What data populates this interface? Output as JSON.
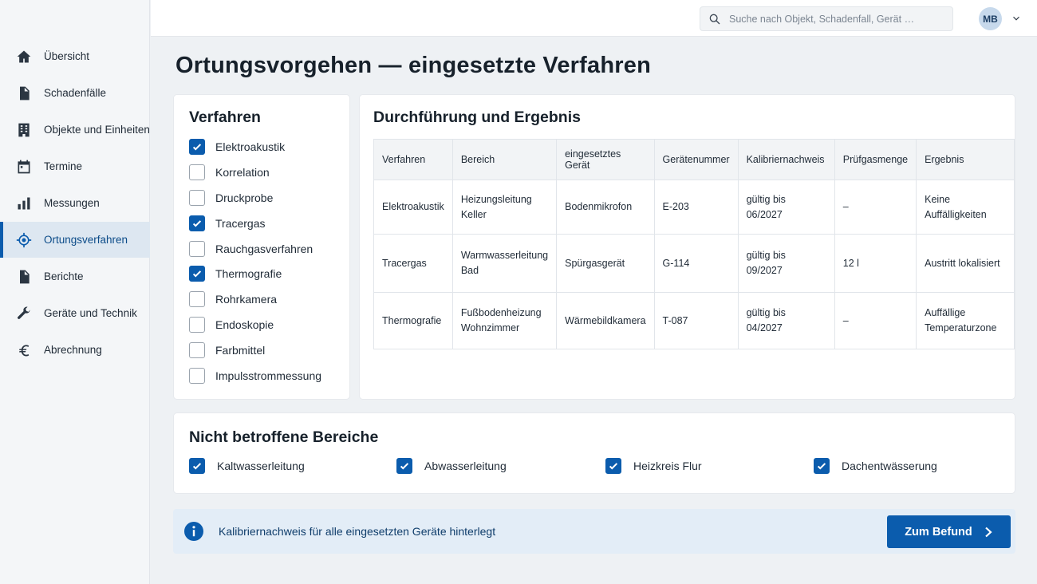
{
  "sidebar": {
    "items": [
      {
        "label": "Übersicht",
        "icon": "home-icon"
      },
      {
        "label": "Schadenfälle",
        "icon": "document-icon"
      },
      {
        "label": "Objekte und Einheiten",
        "icon": "building-icon"
      },
      {
        "label": "Termine",
        "icon": "calendar-icon"
      },
      {
        "label": "Messungen",
        "icon": "bar-chart-icon"
      },
      {
        "label": "Ortungsverfahren",
        "icon": "crosshair-icon",
        "active": true
      },
      {
        "label": "Berichte",
        "icon": "report-icon"
      },
      {
        "label": "Geräte und Technik",
        "icon": "wrench-icon"
      },
      {
        "label": "Abrechnung",
        "icon": "euro-icon"
      }
    ]
  },
  "topbar": {
    "search_placeholder": "Suche nach Objekt, Schadenfall, Gerät …",
    "avatar_initials": "MB"
  },
  "page": {
    "title": "Ortungsvorgehen — eingesetzte Verfahren"
  },
  "verfahren": {
    "title": "Verfahren",
    "items": [
      {
        "label": "Elektroakustik",
        "checked": true
      },
      {
        "label": "Korrelation",
        "checked": false
      },
      {
        "label": "Druckprobe",
        "checked": false
      },
      {
        "label": "Tracergas",
        "checked": true
      },
      {
        "label": "Rauchgasverfahren",
        "checked": false
      },
      {
        "label": "Thermografie",
        "checked": true
      },
      {
        "label": "Rohrkamera",
        "checked": false
      },
      {
        "label": "Endoskopie",
        "checked": false
      },
      {
        "label": "Farbmittel",
        "checked": false
      },
      {
        "label": "Impulsstrommessung",
        "checked": false
      }
    ]
  },
  "result": {
    "title": "Durchführung und Ergebnis",
    "columns": [
      "Verfahren",
      "Bereich",
      "eingesetztes Gerät",
      "Gerätenummer",
      "Kalibriernachweis",
      "Prüfgasmenge",
      "Ergebnis"
    ],
    "rows": [
      {
        "verfahren": "Elektroakustik",
        "bereich_1": "Heizungsleitung",
        "bereich_2": "Keller",
        "geraet": "Bodenmikrofon",
        "nummer": "E-203",
        "kal_1": "gültig bis",
        "kal_2": "06/2027",
        "menge": "–",
        "ergebnis_1": "Keine Auffälligkeiten",
        "ergebnis_2": ""
      },
      {
        "verfahren": "Tracergas",
        "bereich_1": "Warmwasserleitung",
        "bereich_2": "Bad",
        "geraet": "Spürgasgerät",
        "nummer": "G-114",
        "kal_1": "gültig bis",
        "kal_2": "09/2027",
        "menge": "12 l",
        "ergebnis_1": "Austritt lokalisiert",
        "ergebnis_2": ""
      },
      {
        "verfahren": "Thermografie",
        "bereich_1": "Fußbodenheizung",
        "bereich_2": "Wohnzimmer",
        "geraet": "Wärmebildkamera",
        "nummer": "T-087",
        "kal_1": "gültig bis",
        "kal_2": "04/2027",
        "menge": "–",
        "ergebnis_1": "Auffällige",
        "ergebnis_2": "Temperaturzone"
      }
    ]
  },
  "nicht_betroffen": {
    "title": "Nicht betroffene Bereiche",
    "items": [
      {
        "label": "Kaltwasserleitung",
        "checked": true
      },
      {
        "label": "Abwasserleitung",
        "checked": true
      },
      {
        "label": "Heizkreis Flur",
        "checked": true
      },
      {
        "label": "Dachentwässerung",
        "checked": true
      }
    ]
  },
  "info": {
    "text": "Kalibriernachweis für alle eingesetzten Geräte hinterlegt",
    "button_label": "Zum Befund",
    "accent": "#0b5cad"
  }
}
